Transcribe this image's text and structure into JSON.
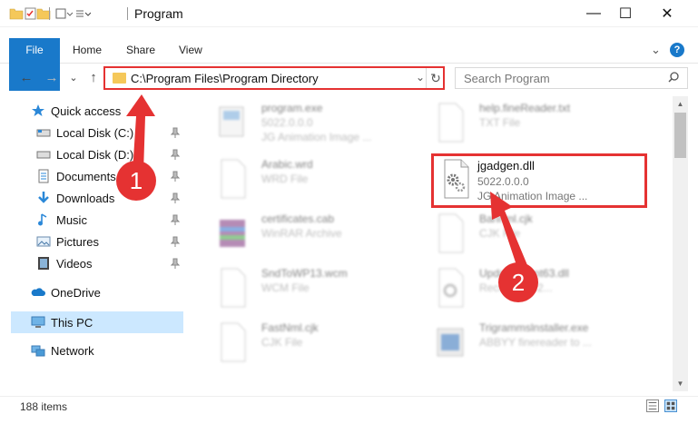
{
  "window": {
    "title": "Program"
  },
  "window_controls": {
    "minimize": "—",
    "maximize": "☐",
    "close": "✕"
  },
  "ribbon": {
    "tabs": [
      "File",
      "Home",
      "Share",
      "View"
    ],
    "expand_glyph": "⌄",
    "help_glyph": "?"
  },
  "nav": {
    "back": "←",
    "forward": "→",
    "recent": "⌄",
    "up": "↑"
  },
  "address": {
    "path": "C:\\Program Files\\Program Directory",
    "dropdown": "⌄",
    "refresh": "↻"
  },
  "search": {
    "placeholder": "Search Program"
  },
  "sidebar": {
    "items": [
      {
        "label": "Quick access",
        "icon": "star-icon",
        "pinned": false
      },
      {
        "label": "Local Disk (C:)",
        "icon": "drive-icon",
        "pinned": true
      },
      {
        "label": "Local Disk (D:)",
        "icon": "drive-icon",
        "pinned": true
      },
      {
        "label": "Documents",
        "icon": "documents-icon",
        "pinned": true
      },
      {
        "label": "Downloads",
        "icon": "download-icon",
        "pinned": true
      },
      {
        "label": "Music",
        "icon": "music-icon",
        "pinned": true
      },
      {
        "label": "Pictures",
        "icon": "pictures-icon",
        "pinned": true
      },
      {
        "label": "Videos",
        "icon": "videos-icon",
        "pinned": true
      },
      {
        "label": "OneDrive",
        "icon": "cloud-icon",
        "pinned": false
      },
      {
        "label": "This PC",
        "icon": "computer-icon",
        "pinned": false
      },
      {
        "label": "Network",
        "icon": "network-icon",
        "pinned": false
      }
    ]
  },
  "files": {
    "left": [
      {
        "name": "program.exe",
        "line1": "5022.0.0.0",
        "line2": "JG Animation Image ..."
      },
      {
        "name": "Arabic.wrd",
        "line1": "WRD File",
        "line2": ""
      },
      {
        "name": "certificates.cab",
        "line1": "WinRAR Archive",
        "line2": ""
      },
      {
        "name": "SndToWP13.wcm",
        "line1": "WCM File",
        "line2": ""
      },
      {
        "name": "FastNml.cjk",
        "line1": "CJK File",
        "line2": ""
      }
    ],
    "right": [
      {
        "name": "help.fineReader.txt",
        "line1": "TXT File",
        "line2": ""
      },
      {
        "name": "jgadgen.dll",
        "line1": "5022.0.0.0",
        "line2": "JG Animation Image ..."
      },
      {
        "name": "Bannml.cjk",
        "line1": "CJK File",
        "line2": ""
      },
      {
        "name": "UpdateAgent63.dll",
        "line1": "Recovery 1.2...",
        "line2": ""
      },
      {
        "name": "Trigrammslnstaller.exe",
        "line1": "ABBYY finereader to ...",
        "line2": ""
      }
    ]
  },
  "status": {
    "item_count": "188 items"
  },
  "callouts": [
    "1",
    "2"
  ],
  "colors": {
    "accent": "#1979ca",
    "highlight": "#e53232",
    "selection": "#cce8ff"
  }
}
